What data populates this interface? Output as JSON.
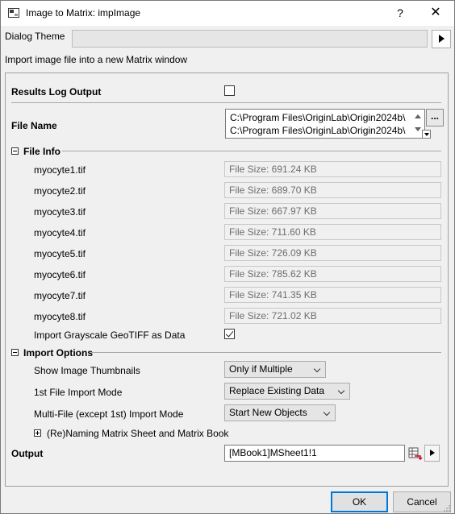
{
  "window": {
    "title": "Image to Matrix: impImage",
    "help_label": "?",
    "close_label": "✕"
  },
  "theme": {
    "label": "Dialog Theme",
    "value": ""
  },
  "description": "Import image file into a new Matrix window",
  "results_log": {
    "label": "Results Log Output",
    "checked": false
  },
  "file_name": {
    "label": "File Name",
    "lines": [
      "C:\\Program Files\\OriginLab\\Origin2024b\\",
      "C:\\Program Files\\OriginLab\\Origin2024b\\"
    ],
    "browse_label": "..."
  },
  "file_info": {
    "label": "File Info",
    "files": [
      {
        "name": "myocyte1.tif",
        "size": "File Size: 691.24 KB"
      },
      {
        "name": "myocyte2.tif",
        "size": "File Size: 689.70 KB"
      },
      {
        "name": "myocyte3.tif",
        "size": "File Size: 667.97 KB"
      },
      {
        "name": "myocyte4.tif",
        "size": "File Size: 711.60 KB"
      },
      {
        "name": "myocyte5.tif",
        "size": "File Size: 726.09 KB"
      },
      {
        "name": "myocyte6.tif",
        "size": "File Size: 785.62 KB"
      },
      {
        "name": "myocyte7.tif",
        "size": "File Size: 741.35 KB"
      },
      {
        "name": "myocyte8.tif",
        "size": "File Size: 721.02 KB"
      }
    ],
    "geotiff": {
      "label": "Import Grayscale GeoTIFF as Data",
      "checked": true
    }
  },
  "import_options": {
    "label": "Import Options",
    "thumbnails": {
      "label": "Show Image Thumbnails",
      "value": "Only if Multiple"
    },
    "first_mode": {
      "label": "1st File Import Mode",
      "value": "Replace Existing Data"
    },
    "multi_mode": {
      "label": "Multi-File (except 1st) Import Mode",
      "value": "Start New Objects"
    },
    "renaming": {
      "label": "(Re)Naming Matrix Sheet and Matrix Book"
    }
  },
  "output": {
    "label": "Output",
    "value": "[MBook1]MSheet1!1"
  },
  "buttons": {
    "ok": "OK",
    "cancel": "Cancel"
  },
  "colors": {
    "default_button_border": "#0078d7",
    "panel_bg": "#f0f0f0"
  }
}
